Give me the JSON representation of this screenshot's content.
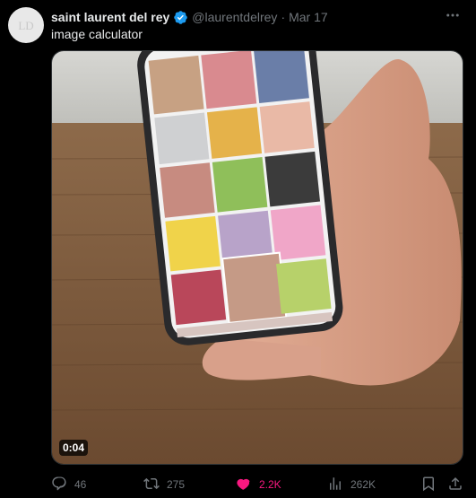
{
  "tweet": {
    "author_name": "saint laurent del rey",
    "handle": "@laurentdelrey",
    "separator": "·",
    "date": "Mar 17",
    "text": "image calculator",
    "avatar_text": "LD"
  },
  "media": {
    "duration": "0:04"
  },
  "actions": {
    "replies": "46",
    "reposts": "275",
    "likes": "2.2K",
    "views": "262K"
  },
  "colors": {
    "background": "#000000",
    "verified": "#1d9bf0",
    "like": "#f91880",
    "muted": "#71767b"
  },
  "icons": [
    "verified-badge-icon",
    "more-icon",
    "reply-icon",
    "repost-icon",
    "like-icon",
    "views-icon",
    "bookmark-icon",
    "share-icon"
  ]
}
